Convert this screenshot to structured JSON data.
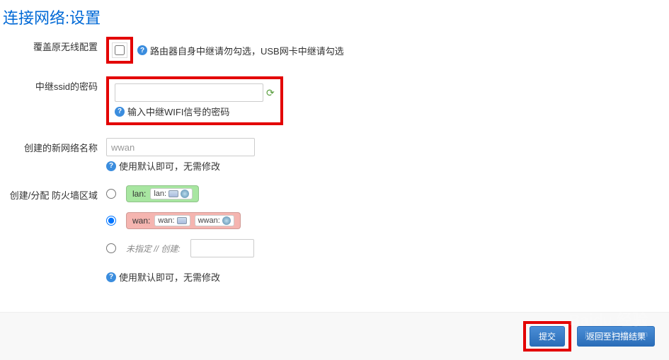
{
  "page_title": "连接网络:设置",
  "overwrite": {
    "label": "覆盖原无线配置",
    "hint": "路由器自身中继请勿勾选，USB网卡中继请勾选"
  },
  "password": {
    "label": "中继ssid的密码",
    "value": "",
    "hint": "输入中继WIFI信号的密码"
  },
  "network_name": {
    "label": "创建的新网络名称",
    "value": "wwan",
    "hint": "使用默认即可，无需修改"
  },
  "firewall": {
    "label": "创建/分配 防火墙区域",
    "lan_zone": "lan:",
    "lan_iface": "lan:",
    "wan_zone": "wan:",
    "wan_iface1": "wan:",
    "wan_iface2": "wwan:",
    "unspecified": "未指定 // 创建:",
    "new_zone_value": "",
    "hint": "使用默认即可，无需修改"
  },
  "footer": {
    "submit": "提交",
    "back": "返回至扫描结果"
  },
  "watermark": {
    "brand": "Baidu 经验",
    "url": "jingyan.baidu.com"
  }
}
